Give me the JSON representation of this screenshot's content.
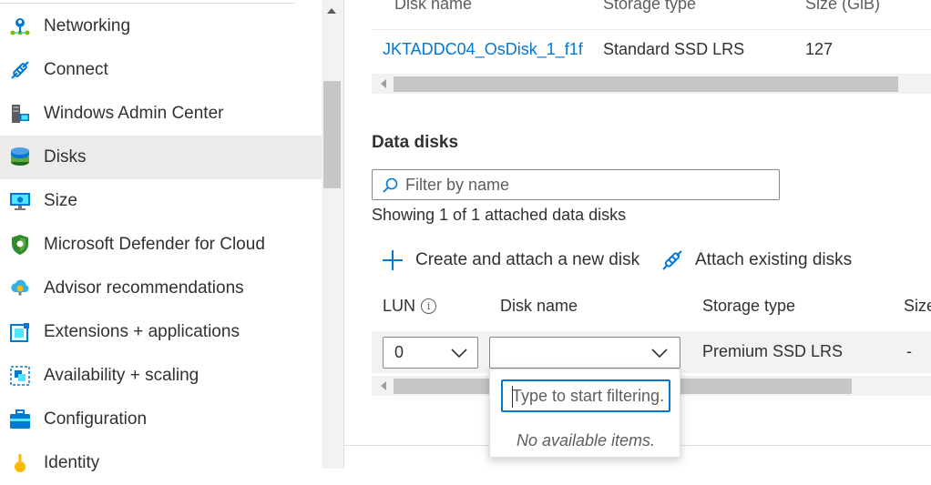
{
  "sidebar": {
    "items": [
      {
        "label": "Networking",
        "icon": "networking-icon"
      },
      {
        "label": "Connect",
        "icon": "connect-icon"
      },
      {
        "label": "Windows Admin Center",
        "icon": "windows-admin-center-icon"
      },
      {
        "label": "Disks",
        "icon": "disks-icon",
        "selected": true
      },
      {
        "label": "Size",
        "icon": "size-icon"
      },
      {
        "label": "Microsoft Defender for Cloud",
        "icon": "defender-shield-icon"
      },
      {
        "label": "Advisor recommendations",
        "icon": "advisor-icon"
      },
      {
        "label": "Extensions + applications",
        "icon": "extensions-icon"
      },
      {
        "label": "Availability + scaling",
        "icon": "availability-icon"
      },
      {
        "label": "Configuration",
        "icon": "configuration-icon"
      },
      {
        "label": "Identity",
        "icon": "identity-icon"
      }
    ]
  },
  "os_disk": {
    "headers": {
      "disk_name": "Disk name",
      "storage_type": "Storage type",
      "size": "Size (GiB)"
    },
    "row": {
      "disk_name": "JKTADDC04_OsDisk_1_f1f",
      "storage_type": "Standard SSD LRS",
      "size": "127"
    }
  },
  "data_disks": {
    "title": "Data disks",
    "filter_placeholder": "Filter by name",
    "showing_text": "Showing 1 of 1 attached data disks",
    "commands": {
      "create": "Create and attach a new disk",
      "attach": "Attach existing disks"
    },
    "headers": {
      "lun": "LUN",
      "disk_name": "Disk name",
      "storage_type": "Storage type",
      "size": "Size"
    },
    "row": {
      "lun": "0",
      "disk_name": "",
      "storage_type": "Premium SSD LRS",
      "size": "-"
    },
    "dropdown": {
      "search_placeholder": "Type to start filtering...",
      "empty_text": "No available items."
    }
  },
  "colors": {
    "accent": "#0078d4",
    "selected_bg": "#edebe9"
  }
}
